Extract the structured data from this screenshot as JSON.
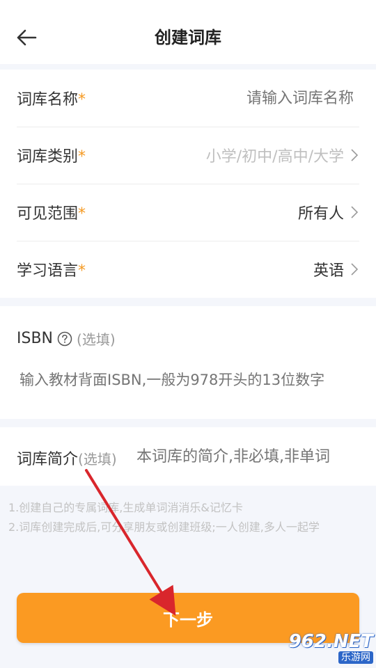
{
  "header": {
    "title": "创建词库"
  },
  "form": {
    "name": {
      "label": "词库名称",
      "required_mark": "*",
      "placeholder": "请输入词库名称"
    },
    "category": {
      "label": "词库类别",
      "required_mark": "*",
      "value": "小学/初中/高中/大学"
    },
    "visibility": {
      "label": "可见范围",
      "required_mark": "*",
      "value": "所有人"
    },
    "language": {
      "label": "学习语言",
      "required_mark": "*",
      "value": "英语"
    }
  },
  "isbn": {
    "label": "ISBN",
    "optional": "(选填)",
    "placeholder": "输入教材背面ISBN,一般为978开头的13位数字"
  },
  "intro": {
    "label": "词库简介",
    "optional": "(选填)",
    "placeholder": "本词库的简介,非必填,非单词"
  },
  "tips": [
    "1.创建自己的专属词库,生成单词消消乐&记忆卡",
    "2.词库创建完成后,可分享朋友或创建班级;一人创建,多人一起学"
  ],
  "buttons": {
    "next_label": "下一步"
  },
  "watermark": {
    "top": "962.NET",
    "bottom": "乐游网"
  },
  "colors": {
    "accent": "#fb9a22",
    "required": "#f59a23",
    "annotation_arrow": "#d9262c"
  },
  "icons": {
    "back": "arrow-left-icon",
    "chevron": "chevron-right-icon",
    "help": "question-circle-icon"
  }
}
